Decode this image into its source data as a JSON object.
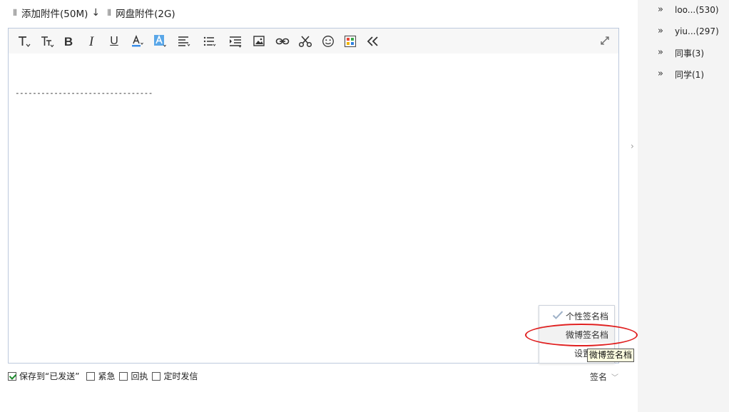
{
  "attachments": {
    "add_label": "添加附件(50M)",
    "netdisk_label": "网盘附件(2G)",
    "down_arrow": "↓"
  },
  "toolbar": {
    "icons": [
      "font-family-icon",
      "font-size-icon",
      "bold-icon",
      "italic-icon",
      "underline-icon",
      "font-color-icon",
      "background-color-icon",
      "align-icon",
      "list-icon",
      "indent-icon",
      "image-icon",
      "link-icon",
      "cut-icon",
      "emoji-icon",
      "template-icon",
      "collapse-icon"
    ],
    "bold": "B",
    "italic": "I",
    "underline": "U",
    "expand_icon": "expand-icon"
  },
  "editor": {
    "content": "--------------------------------"
  },
  "signature_menu": {
    "items": [
      {
        "label": "个性签名档",
        "checked": true
      },
      {
        "label": "微博签名档",
        "checked": false
      },
      {
        "label": "设置"
      }
    ],
    "tooltip": "微博签名档"
  },
  "options": [
    {
      "label": "保存到“已发送”",
      "checked": true
    },
    {
      "label": "紧急",
      "checked": false
    },
    {
      "label": "回执",
      "checked": false
    },
    {
      "label": "定时发信",
      "checked": false
    }
  ],
  "signature_dropdown": {
    "label": "签名"
  },
  "sidebar": {
    "items": [
      {
        "label": "loo...(530)"
      },
      {
        "label": "yiu...(297)"
      },
      {
        "label": "同事(3)"
      },
      {
        "label": "同学(1)"
      }
    ]
  },
  "colors": {
    "editor_border": "#bcc9dd",
    "annotation_red": "#e02020",
    "tooltip_bg": "#ffffe1",
    "sidebar_bg": "#f4f4f4",
    "check_green": "#1a8a2a"
  }
}
